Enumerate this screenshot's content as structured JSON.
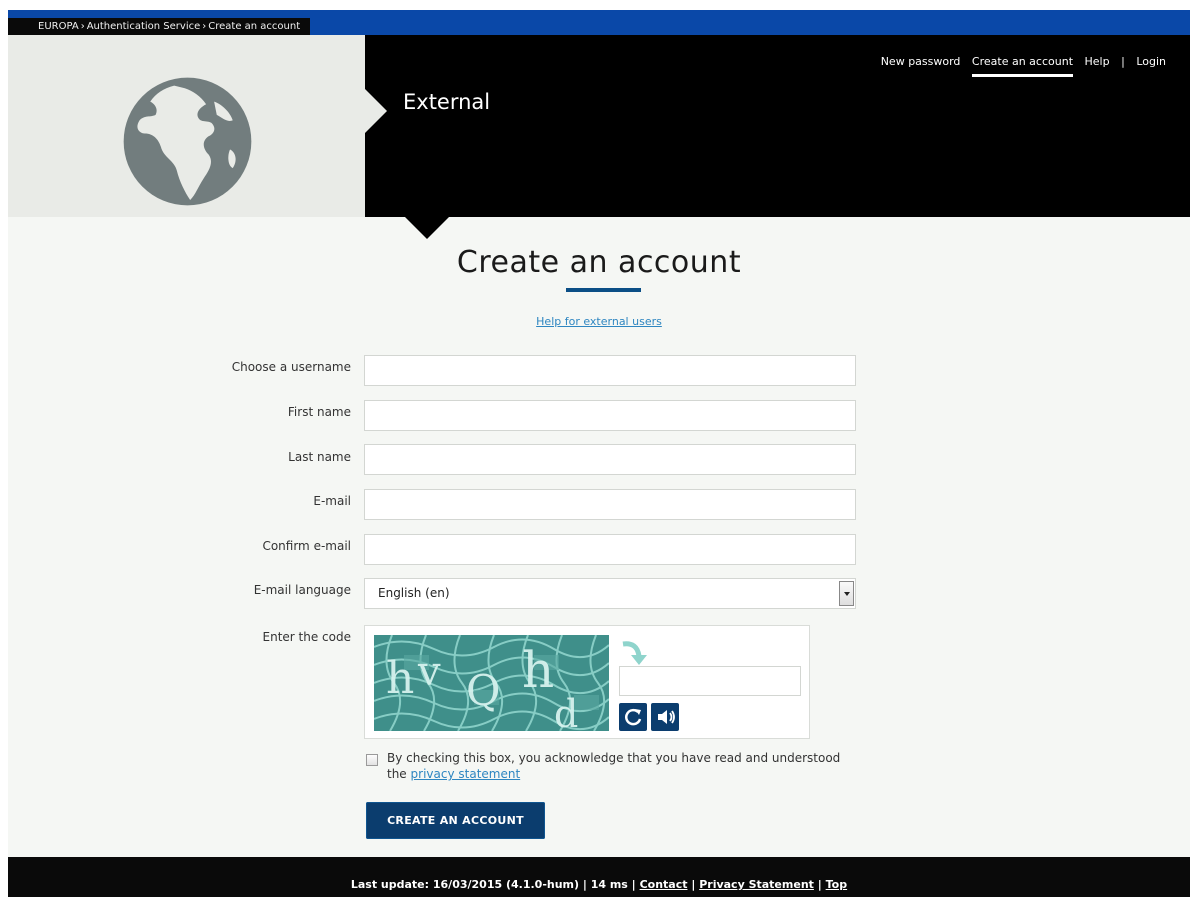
{
  "breadcrumb": {
    "items": [
      "EUROPA",
      "Authentication Service",
      "Create an account"
    ],
    "separator": "›"
  },
  "header": {
    "site_name": "External",
    "nav": {
      "new_password": "New password",
      "create_account": "Create an account",
      "help": "Help",
      "divider": "|",
      "login": "Login"
    }
  },
  "main": {
    "title": "Create an account",
    "help_link": "Help for external users"
  },
  "form": {
    "username_label": "Choose a username",
    "username_value": "",
    "firstname_label": "First name",
    "firstname_value": "",
    "lastname_label": "Last name",
    "lastname_value": "",
    "email_label": "E-mail",
    "email_value": "",
    "confirm_email_label": "Confirm e-mail",
    "confirm_email_value": "",
    "language_label": "E-mail language",
    "language_value": "English (en)",
    "code_label": "Enter the code",
    "captcha_chars": [
      "h",
      "v",
      "Q",
      "h",
      "d"
    ],
    "consent_text": "By checking this box, you acknowledge that you have read and understood the",
    "consent_link": "privacy statement",
    "consent_checked": false,
    "submit_label": "CREATE AN ACCOUNT"
  },
  "footer": {
    "last_update": "Last update: 16/03/2015 (4.1.0-hum) | 14 ms |",
    "contact": "Contact",
    "privacy": "Privacy Statement",
    "top": "Top",
    "divider": "|"
  },
  "colors": {
    "top_bar": "#0a48a8",
    "header_black": "#000000",
    "accent_blue": "#0b3d6e",
    "link_blue": "#2e86c1",
    "page_bg": "#f5f7f4"
  },
  "icons": [
    "globe-logo-icon",
    "captcha-arrow-icon",
    "refresh-icon",
    "audio-icon",
    "chevron-down-icon"
  ]
}
